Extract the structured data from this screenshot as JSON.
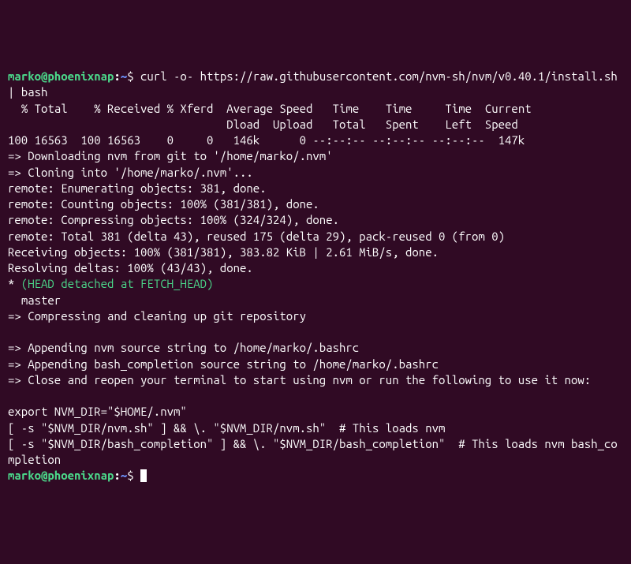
{
  "prompt1": {
    "user": "marko@phoenixnap",
    "colon": ":",
    "path": "~",
    "dollar": "$ ",
    "cmd": "curl -o- https://raw.githubusercontent.com/nvm-sh/nvm/v0.40.1/install.sh | bash"
  },
  "curl_header1": "  % Total    % Received % Xferd  Average Speed   Time    Time     Time  Current",
  "curl_header2": "                                 Dload  Upload   Total   Spent    Left  Speed",
  "curl_row": "100 16563  100 16563    0     0   146k      0 --:--:-- --:--:-- --:--:--  147k",
  "out1": "=> Downloading nvm from git to '/home/marko/.nvm'",
  "out2": "=> Cloning into '/home/marko/.nvm'...",
  "out3": "remote: Enumerating objects: 381, done.",
  "out4": "remote: Counting objects: 100% (381/381), done.",
  "out5": "remote: Compressing objects: 100% (324/324), done.",
  "out6": "remote: Total 381 (delta 43), reused 175 (delta 29), pack-reused 0 (from 0)",
  "out7": "Receiving objects: 100% (381/381), 383.82 KiB | 2.61 MiB/s, done.",
  "out8": "Resolving deltas: 100% (43/43), done.",
  "star": "* ",
  "detached": "(HEAD detached at FETCH_HEAD)",
  "master": "  master",
  "out9": "=> Compressing and cleaning up git repository",
  "blank": "",
  "out10": "=> Appending nvm source string to /home/marko/.bashrc",
  "out11": "=> Appending bash_completion source string to /home/marko/.bashrc",
  "out12": "=> Close and reopen your terminal to start using nvm or run the following to use it now:",
  "out13": "export NVM_DIR=\"$HOME/.nvm\"",
  "out14": "[ -s \"$NVM_DIR/nvm.sh\" ] && \\. \"$NVM_DIR/nvm.sh\"  # This loads nvm",
  "out15": "[ -s \"$NVM_DIR/bash_completion\" ] && \\. \"$NVM_DIR/bash_completion\"  # This loads nvm bash_completion",
  "prompt2": {
    "user": "marko@phoenixnap",
    "colon": ":",
    "path": "~",
    "dollar": "$ "
  }
}
